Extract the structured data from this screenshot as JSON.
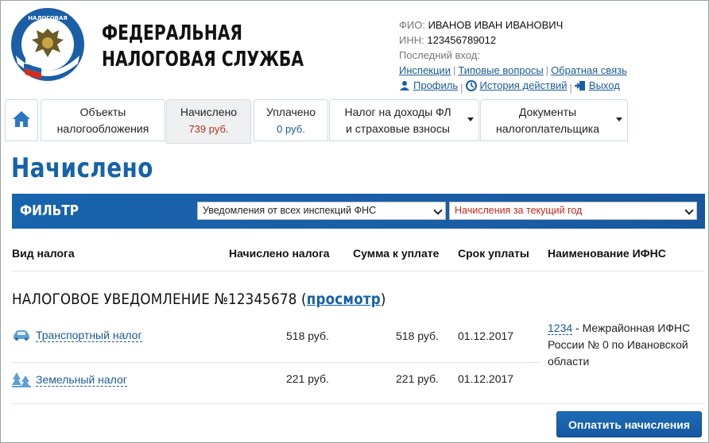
{
  "header": {
    "brand_line1": "ФЕДЕРАЛЬНАЯ",
    "brand_line2": "НАЛОГОВАЯ СЛУЖБА",
    "logo_icon": "fns-emblem-icon"
  },
  "user": {
    "fio_label": "ФИО:",
    "fio_value": "ИВАНОВ ИВАН ИВАНОВИЧ",
    "inn_label": "ИНН:",
    "inn_value": "123456789012",
    "last_login_label": "Последний вход:",
    "links": [
      "Инспекции",
      "Типовые вопросы",
      "Обратная связь"
    ],
    "profile": "Профиль",
    "history": "История действий",
    "logout": "Выход"
  },
  "tabs": [
    {
      "label1": "Объекты",
      "label2": "налогообложения"
    },
    {
      "label1": "Начислено",
      "label2": "739 руб."
    },
    {
      "label1": "Уплачено",
      "label2": "0 руб."
    },
    {
      "label1": "Налог на доходы ФЛ",
      "label2": "и страховые взносы"
    },
    {
      "label1": "Документы",
      "label2": "налогоплательщика"
    }
  ],
  "page": {
    "title": "Начислено"
  },
  "filter": {
    "label": "ФИЛЬТР",
    "select1": "Уведомления от всех инспекций ФНС",
    "select2": "Начисления за текущий год"
  },
  "table": {
    "headers": [
      "Вид налога",
      "Начислено налога",
      "Сумма к уплате",
      "Срок уплаты",
      "Наименование ИФНС"
    ],
    "notice_prefix": "НАЛОГОВОЕ УВЕДОМЛЕНИЕ №12345678 (",
    "notice_link": "просмотр",
    "notice_suffix": ")",
    "rows": [
      {
        "icon": "car-icon",
        "name": "Транспортный налог",
        "accrued": "518 руб.",
        "due": "518 руб.",
        "deadline": "01.12.2017"
      },
      {
        "icon": "trees-icon",
        "name": "Земельный налог",
        "accrued": "221 руб.",
        "due": "221 руб.",
        "deadline": "01.12.2017"
      }
    ],
    "ifns_code": "1234",
    "ifns_name": " - Межрайонная ИФНС России № 0 по Ивановской области"
  },
  "actions": {
    "pay_button": "Оплатить начисления"
  },
  "colors": {
    "brand_blue": "#1a5ea6",
    "title_blue": "#1662a8",
    "accent_red": "#b1331a"
  }
}
